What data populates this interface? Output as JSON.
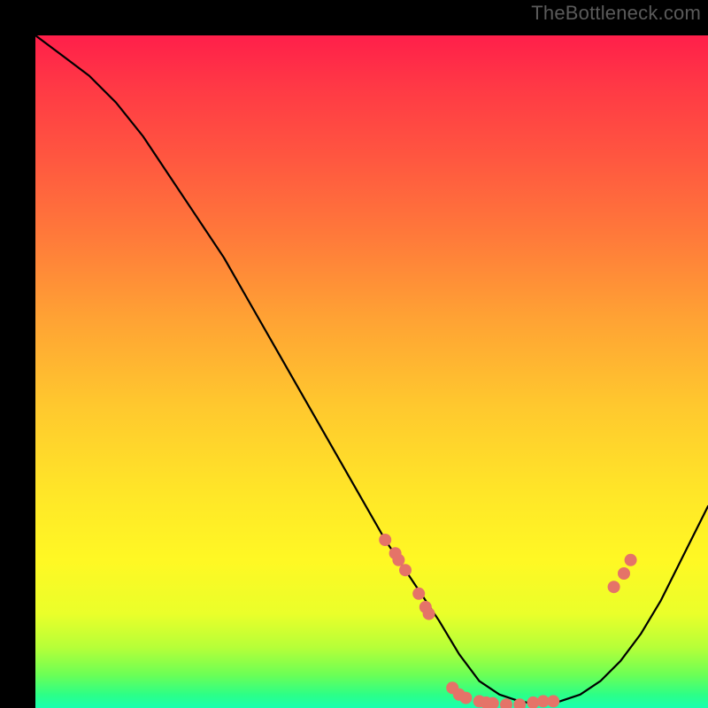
{
  "watermark": "TheBottleneck.com",
  "chart_data": {
    "type": "line",
    "title": "",
    "xlabel": "",
    "ylabel": "",
    "xlim": [
      0,
      100
    ],
    "ylim": [
      0,
      100
    ],
    "grid": false,
    "x": [
      0,
      4,
      8,
      12,
      16,
      20,
      24,
      28,
      32,
      36,
      40,
      44,
      48,
      52,
      56,
      60,
      63,
      66,
      69,
      72,
      75,
      78,
      81,
      84,
      87,
      90,
      93,
      96,
      100
    ],
    "values": [
      100,
      97,
      94,
      90,
      85,
      79,
      73,
      67,
      60,
      53,
      46,
      39,
      32,
      25,
      19,
      13,
      8,
      4,
      2,
      1,
      0.5,
      1,
      2,
      4,
      7,
      11,
      16,
      22,
      30
    ],
    "markers": [
      {
        "x": 52,
        "y": 25
      },
      {
        "x": 53.5,
        "y": 23
      },
      {
        "x": 54,
        "y": 22
      },
      {
        "x": 55,
        "y": 20.5
      },
      {
        "x": 57,
        "y": 17
      },
      {
        "x": 58,
        "y": 15
      },
      {
        "x": 58.5,
        "y": 14
      },
      {
        "x": 62,
        "y": 3
      },
      {
        "x": 63,
        "y": 2
      },
      {
        "x": 64,
        "y": 1.5
      },
      {
        "x": 66,
        "y": 1
      },
      {
        "x": 67,
        "y": 0.8
      },
      {
        "x": 68,
        "y": 0.7
      },
      {
        "x": 70,
        "y": 0.5
      },
      {
        "x": 72,
        "y": 0.5
      },
      {
        "x": 74,
        "y": 0.8
      },
      {
        "x": 75.5,
        "y": 1
      },
      {
        "x": 77,
        "y": 1
      },
      {
        "x": 86,
        "y": 18
      },
      {
        "x": 87.5,
        "y": 20
      },
      {
        "x": 88.5,
        "y": 22
      }
    ],
    "marker_color": "#e57368",
    "marker_radius": 7
  }
}
